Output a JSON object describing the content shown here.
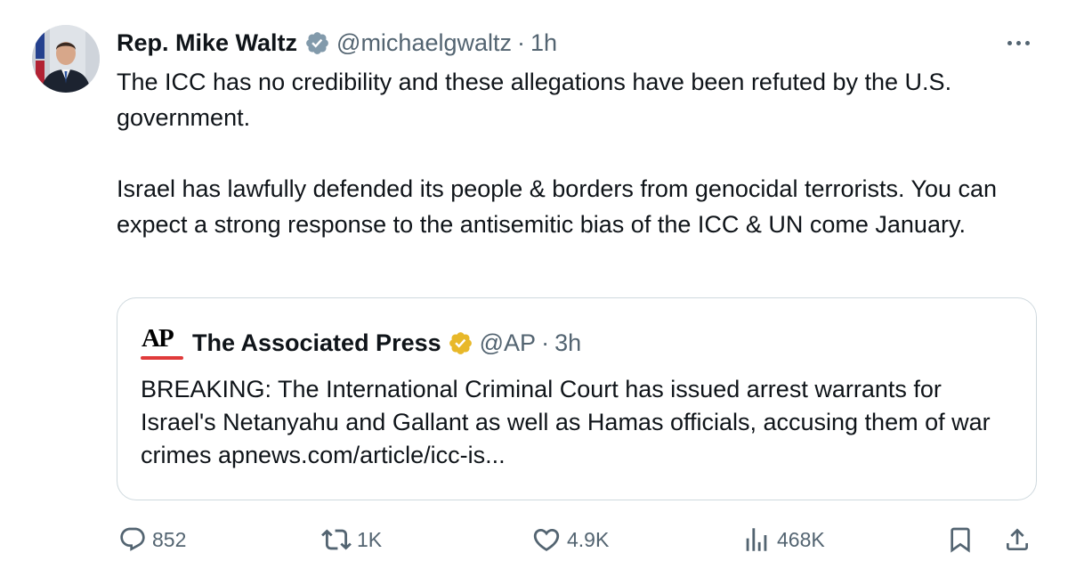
{
  "tweet": {
    "author_name": "Rep. Mike Waltz",
    "handle": "@michaelgwaltz",
    "separator": "·",
    "timestamp": "1h",
    "verified_icon": "verified-badge-blue",
    "more_icon": "more-options-icon",
    "paragraphs": [
      "The ICC has no credibility and these allegations have been refuted by the U.S. government.",
      "Israel has lawfully defended its people & borders from genocidal terrorists. You can expect a strong response to the antisemitic bias of the ICC & UN come January."
    ]
  },
  "quote": {
    "logo_text": "AP",
    "author_name": "The Associated Press",
    "verified_icon": "verified-badge-gold",
    "handle": "@AP",
    "separator": "·",
    "timestamp": "3h",
    "text": "BREAKING: The International Criminal Court has issued arrest warrants for Israel's Netanyahu and Gallant as well as Hamas officials, accusing them of war crimes apnews.com/article/icc-is..."
  },
  "actions": {
    "reply_count": "852",
    "repost_count": "1K",
    "like_count": "4.9K",
    "views_count": "468K"
  },
  "colors": {
    "text_primary": "#0f1419",
    "text_secondary": "#536471",
    "verified_blue": "#829aab",
    "verified_gold": "#e8b829",
    "ap_red": "#e03a3a",
    "card_border": "#cfd9de"
  }
}
